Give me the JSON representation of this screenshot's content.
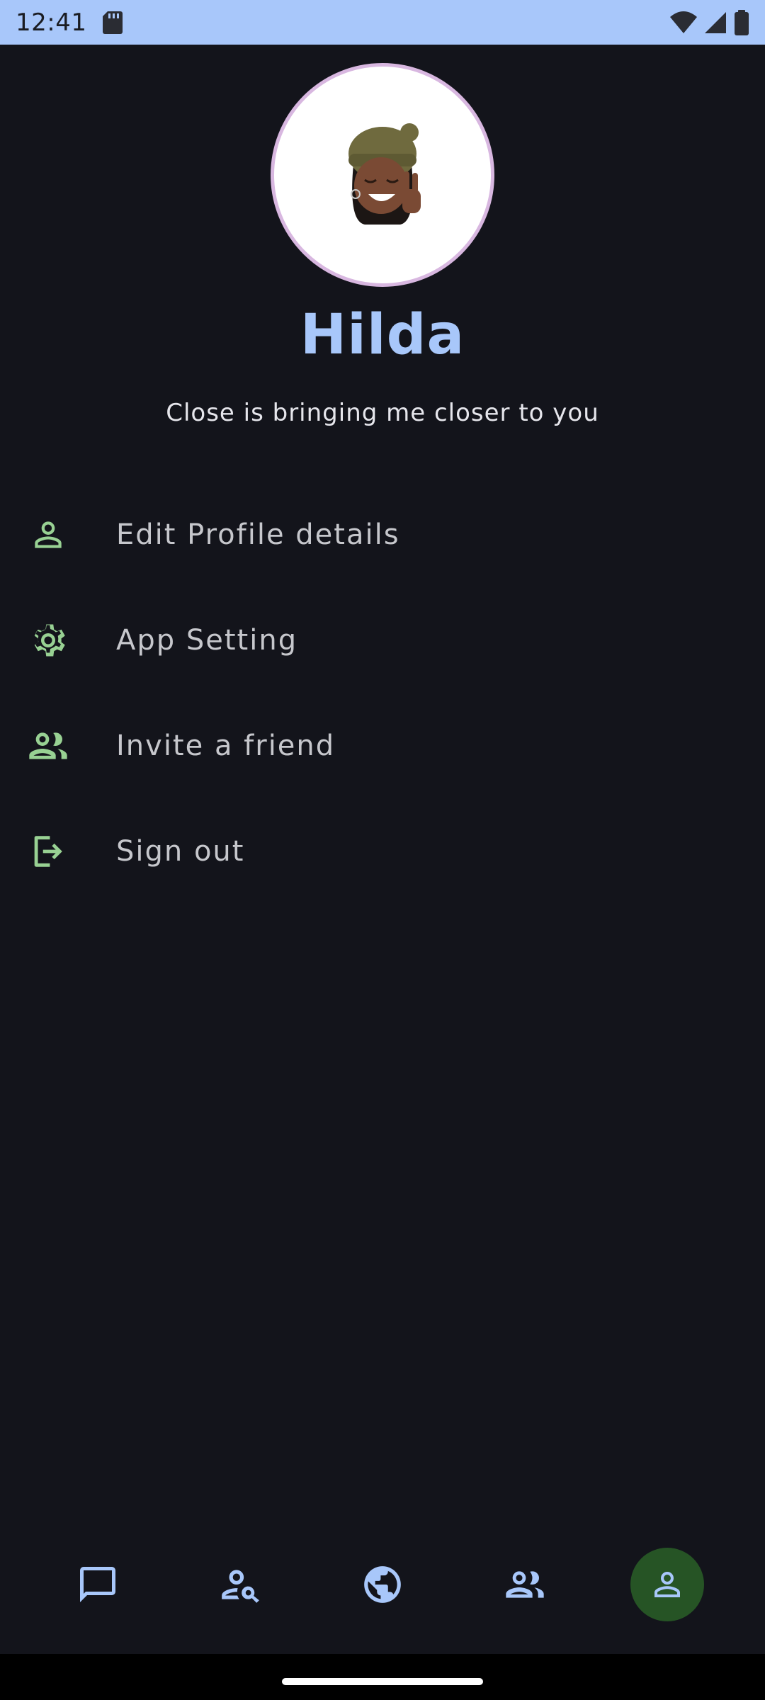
{
  "status_bar": {
    "time": "12:41",
    "icons": [
      "sd-card-icon",
      "wifi-icon",
      "cell-signal-icon",
      "battery-icon"
    ]
  },
  "profile": {
    "name": "Hilda",
    "status": "Close is bringing me closer to you",
    "avatar": "memoji-avatar"
  },
  "menu": {
    "items": [
      {
        "label": "Edit Profile details",
        "icon": "person-icon"
      },
      {
        "label": "App Setting",
        "icon": "gear-icon"
      },
      {
        "label": "Invite a friend",
        "icon": "group-icon"
      },
      {
        "label": "Sign out",
        "icon": "logout-icon"
      }
    ]
  },
  "bottom_nav": {
    "items": [
      {
        "icon": "chat-icon"
      },
      {
        "icon": "person-search-icon"
      },
      {
        "icon": "globe-icon"
      },
      {
        "icon": "group-icon"
      },
      {
        "icon": "person-icon",
        "active": true
      }
    ]
  },
  "colors": {
    "background": "#13141b",
    "status_bar": "#a8c7fa",
    "accent_blue": "#a8c7fa",
    "menu_icon_green": "#98d193",
    "active_nav_bg": "#265425"
  }
}
